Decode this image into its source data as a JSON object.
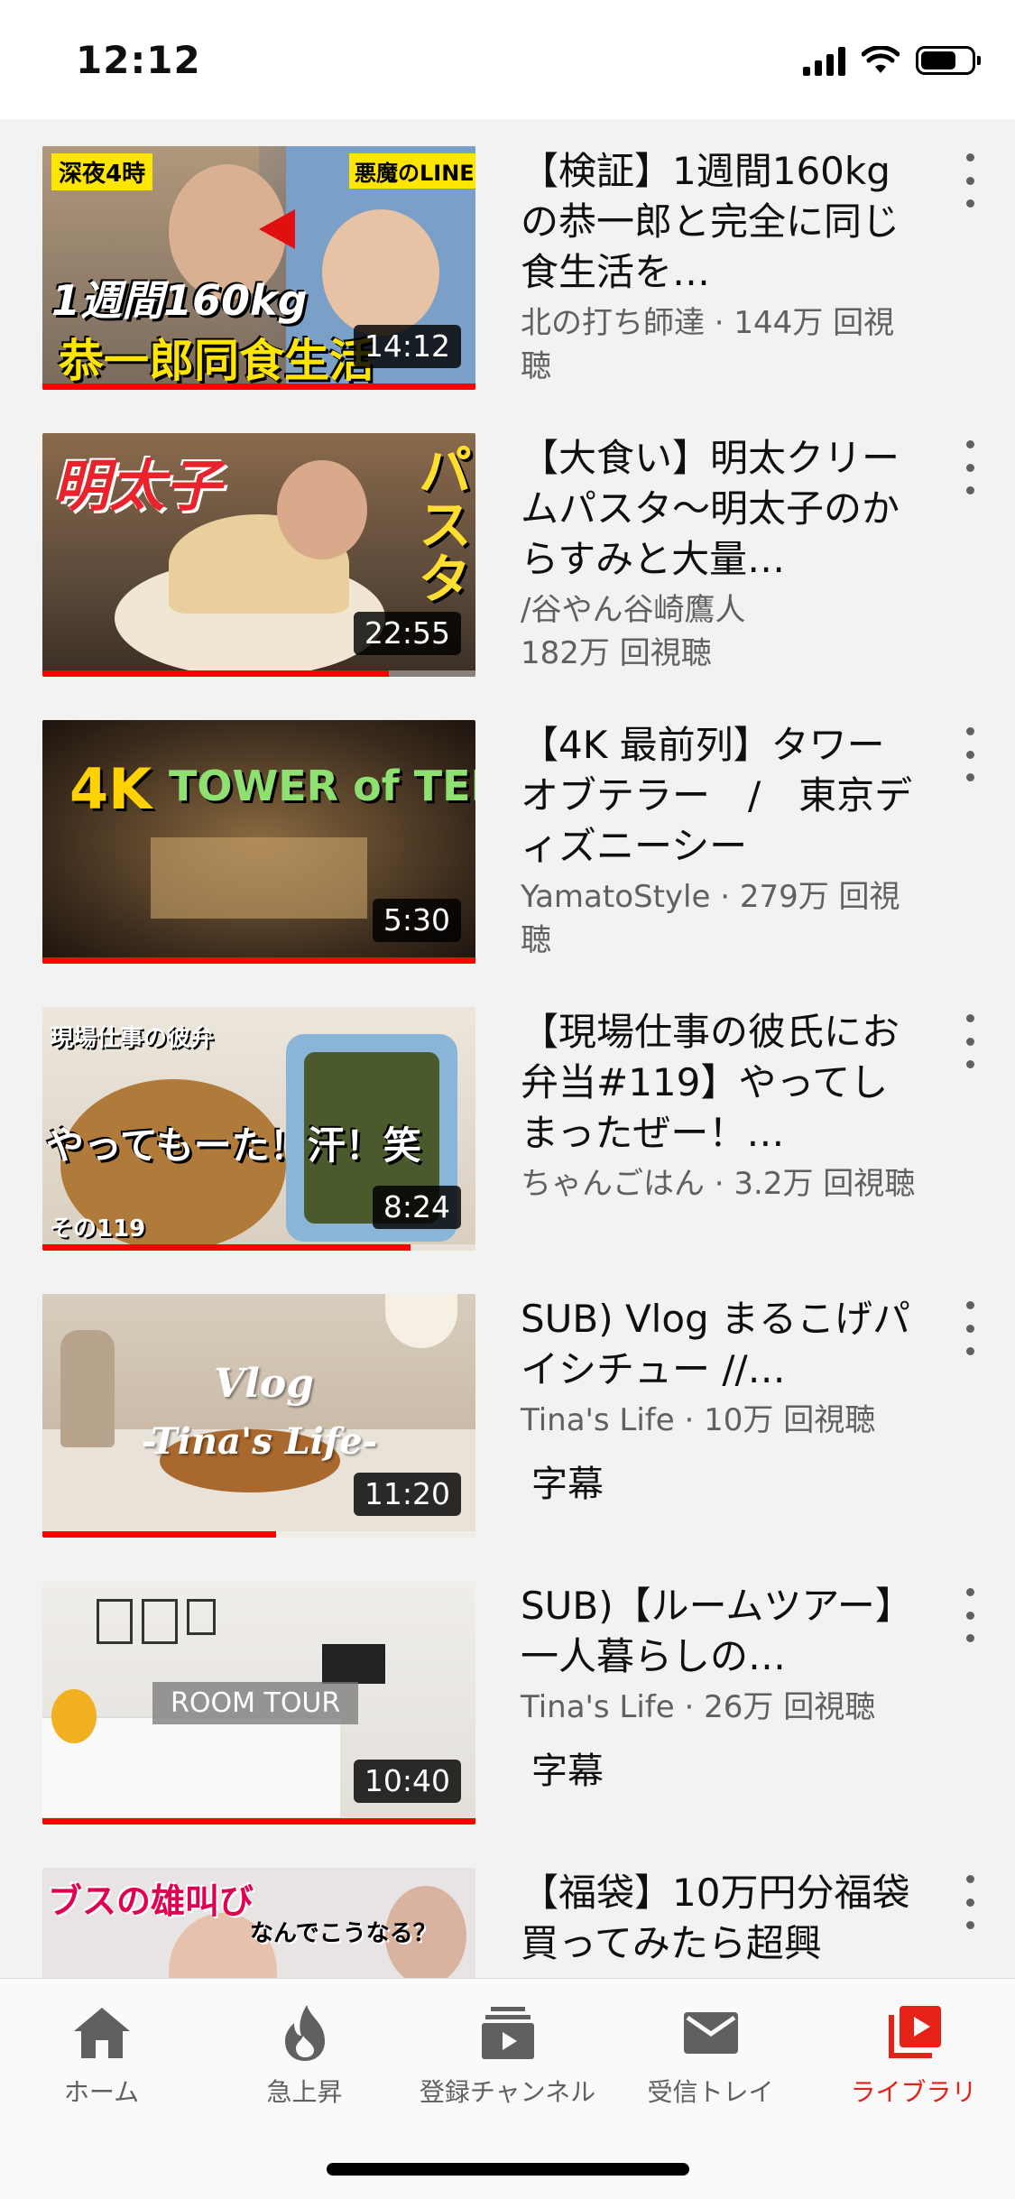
{
  "status": {
    "time": "12:12"
  },
  "videos": [
    {
      "title": "【検証】1週間160kgの恭一郎と完全に同じ食生活を…",
      "meta": "北の打ち師達 · 144万 回視聴",
      "duration": "14:12",
      "progress": 1.0,
      "thumb_texts": [
        "深夜4時",
        "悪魔のLINE",
        "1週間160kg",
        "恭一郎同食生活"
      ],
      "colors": {
        "bg": "#8c7f73",
        "accent": "#ffe600"
      }
    },
    {
      "title": "【大食い】明太クリームパスタ〜明太子のからすみと大量…",
      "meta": "/谷やん谷崎鷹人",
      "meta2": "182万 回視聴",
      "duration": "22:55",
      "progress": 0.8,
      "thumb_texts": [
        "明太子",
        "パスタ"
      ],
      "colors": {
        "bg": "#5c4a3a",
        "accent": "#ffde2e"
      }
    },
    {
      "title": "【4K 最前列】タワーオブテラー　/　東京ディズニーシー",
      "meta": "YamatoStyle · 279万 回視聴",
      "duration": "5:30",
      "progress": 1.0,
      "thumb_texts": [
        "4K",
        "TOWER of TERROR"
      ],
      "colors": {
        "bg": "#3a2a1c",
        "accent": "#ffd200"
      }
    },
    {
      "title": "【現場仕事の彼氏にお弁当#119】やってしまったぜー！…",
      "meta": "ちゃんごはん · 3.2万 回視聴",
      "duration": "8:24",
      "progress": 0.85,
      "thumb_texts": [
        "現場仕事の彼弁",
        "やってもーた！汗！笑",
        "その119"
      ],
      "colors": {
        "bg": "#d9cfc0",
        "accent": "#ffffff"
      }
    },
    {
      "title": "SUB) Vlog まるこげパイシチュー //…",
      "meta": "Tina's Life · 10万 回視聴",
      "caption": "字幕",
      "duration": "11:20",
      "progress": 0.54,
      "thumb_texts": [
        "Vlog",
        "-Tina's Life-"
      ],
      "colors": {
        "bg": "#cdbfae",
        "accent": "#ffffff"
      }
    },
    {
      "title": "SUB)【ルームツアー】一人暮らしの…",
      "meta": "Tina's Life · 26万 回視聴",
      "caption": "字幕",
      "duration": "10:40",
      "progress": 1.0,
      "thumb_texts": [
        "ROOM TOUR"
      ],
      "colors": {
        "bg": "#e8e6e2",
        "accent": "#ffffff"
      }
    },
    {
      "title": "【福袋】10万円分福袋買ってみたら超興",
      "meta": "",
      "duration": "",
      "progress": 0,
      "thumb_texts": [
        "ブスの雄叫び",
        "なんでこうなる？"
      ],
      "colors": {
        "bg": "#e9e4e4",
        "accent": "#e00052"
      }
    }
  ],
  "tabs": [
    {
      "label": "ホーム",
      "icon": "home-icon"
    },
    {
      "label": "急上昇",
      "icon": "flame-icon"
    },
    {
      "label": "登録チャンネル",
      "icon": "subscriptions-icon"
    },
    {
      "label": "受信トレイ",
      "icon": "mail-icon"
    },
    {
      "label": "ライブラリ",
      "icon": "library-icon",
      "active": true
    }
  ],
  "theme": {
    "accent": "#e62117",
    "feed_bg": "#f2f2f2"
  }
}
